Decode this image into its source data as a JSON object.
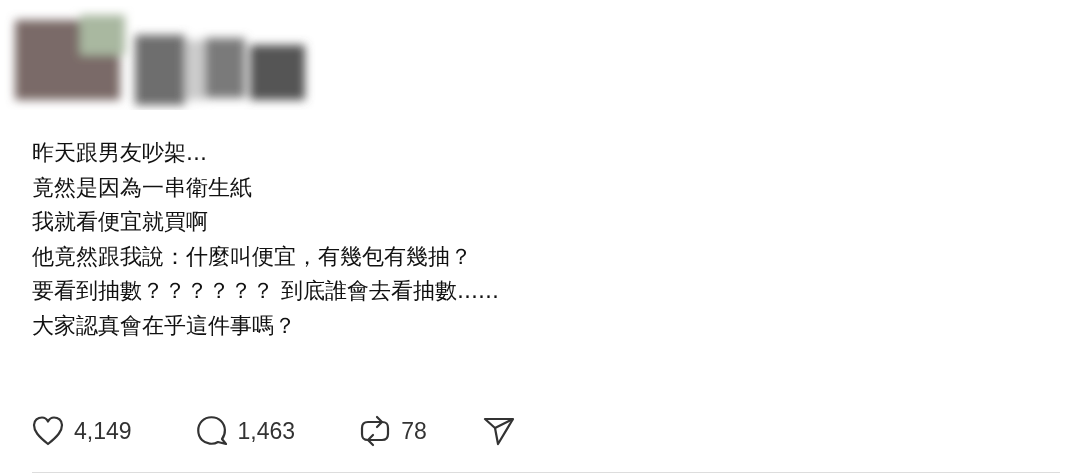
{
  "post": {
    "lines": [
      "昨天跟男友吵架...",
      "竟然是因為一串衛生紙",
      "我就看便宜就買啊",
      "他竟然跟我說：什麼叫便宜，有幾包有幾抽？",
      "要看到抽數？？？？？？ 到底誰會去看抽數......",
      "大家認真會在乎這件事嗎？"
    ]
  },
  "actions": [
    {
      "kind": "like",
      "count": "4,149"
    },
    {
      "kind": "reply",
      "count": "1,463"
    },
    {
      "kind": "repost",
      "count": "78"
    },
    {
      "kind": "share"
    }
  ]
}
